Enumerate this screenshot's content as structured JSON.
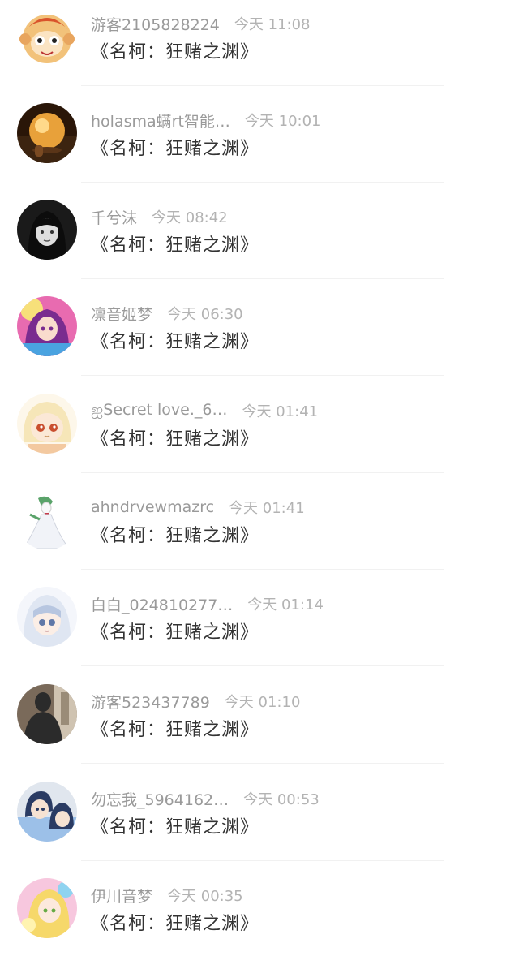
{
  "comments": [
    {
      "username": "游客2105828224",
      "time": "今天 11:08",
      "title": "《名柯：狂赌之渊》",
      "avatar_icon": "monkey-king-avatar-icon",
      "avatar_colors": [
        "#f2c27a",
        "#d9532b",
        "#ffffff"
      ]
    },
    {
      "username": "holasma螨rt智能…",
      "time": "今天 10:01",
      "title": "《名柯：狂赌之渊》",
      "avatar_icon": "crystal-ball-avatar-icon",
      "avatar_colors": [
        "#2a1608",
        "#e8a13a",
        "#ffd98a"
      ]
    },
    {
      "username": "千兮沫",
      "time": "今天 08:42",
      "title": "《名柯：狂赌之渊》",
      "avatar_icon": "dark-hair-girl-avatar-icon",
      "avatar_colors": [
        "#1a1a1a",
        "#dedede",
        "#555555"
      ]
    },
    {
      "username": "凛音姬梦",
      "time": "今天 06:30",
      "title": "《名柯：狂赌之渊》",
      "avatar_icon": "purple-anime-girl-avatar-icon",
      "avatar_colors": [
        "#7a2c8f",
        "#e86bb0",
        "#4aa3e0"
      ]
    },
    {
      "username": "ஐSecret love._6…",
      "time": "今天 01:41",
      "title": "《名柯：狂赌之渊》",
      "avatar_icon": "blonde-chibi-avatar-icon",
      "avatar_colors": [
        "#f6e6b8",
        "#f3c9a0",
        "#c94e2e"
      ]
    },
    {
      "username": "ahndrvewmazrc",
      "time": "今天 01:41",
      "title": "《名柯：狂赌之渊》",
      "avatar_icon": "gardevoir-avatar-icon",
      "avatar_colors": [
        "#f8f8fa",
        "#5aa36a",
        "#c63a4a"
      ]
    },
    {
      "username": "白白_024810277…",
      "time": "今天 01:14",
      "title": "《名柯：狂赌之渊》",
      "avatar_icon": "silver-hair-girl-avatar-icon",
      "avatar_colors": [
        "#dfe6f2",
        "#b7c6e0",
        "#5f78a8"
      ]
    },
    {
      "username": "游客523437789",
      "time": "今天 01:10",
      "title": "《名柯：狂赌之渊》",
      "avatar_icon": "dark-photo-avatar-icon",
      "avatar_colors": [
        "#2b2b2b",
        "#7a6a5a",
        "#cfc3b1"
      ]
    },
    {
      "username": "勿忘我_5964162…",
      "time": "今天 00:53",
      "title": "《名柯：狂赌之渊》",
      "avatar_icon": "detective-conan-avatar-icon",
      "avatar_colors": [
        "#2a3b63",
        "#9cc0e8",
        "#e0e6ee"
      ]
    },
    {
      "username": "伊川音梦",
      "time": "今天 00:35",
      "title": "《名柯：狂赌之渊》",
      "avatar_icon": "idol-girl-avatar-icon",
      "avatar_colors": [
        "#f7c7de",
        "#f6d86a",
        "#8fd3f0"
      ]
    }
  ]
}
